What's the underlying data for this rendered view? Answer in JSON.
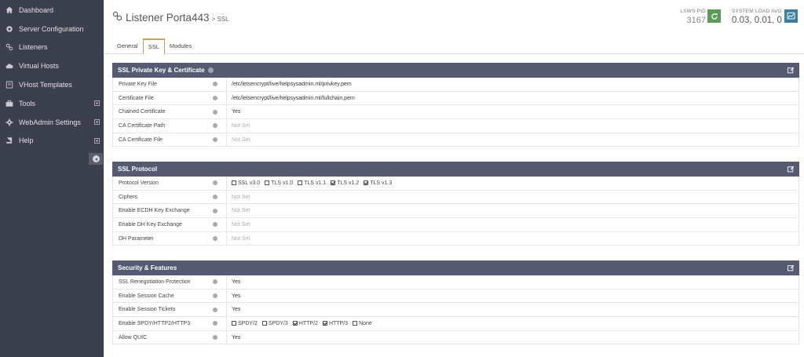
{
  "sidebar": {
    "items": [
      {
        "label": "Dashboard",
        "icon": "home-icon",
        "expandable": false
      },
      {
        "label": "Server Configuration",
        "icon": "server-icon",
        "expandable": false
      },
      {
        "label": "Listeners",
        "icon": "link-icon",
        "expandable": false
      },
      {
        "label": "Virtual Hosts",
        "icon": "cloud-icon",
        "expandable": false
      },
      {
        "label": "VHost Templates",
        "icon": "template-icon",
        "expandable": false
      },
      {
        "label": "Tools",
        "icon": "briefcase-icon",
        "expandable": true
      },
      {
        "label": "WebAdmin Settings",
        "icon": "gear-icon",
        "expandable": true
      },
      {
        "label": "Help",
        "icon": "book-icon",
        "expandable": true
      }
    ]
  },
  "header": {
    "title": "Listener Porta443",
    "subtitle": "> SSL",
    "pid_label": "LSWS PID",
    "pid_value": "3167",
    "load_label": "SYSTEM LOAD AVG",
    "load_value": "0.03, 0.01, 0"
  },
  "tabs": [
    "General",
    "SSL",
    "Modules"
  ],
  "active_tab": "SSL",
  "panels": [
    {
      "title": "SSL Private Key & Certificate",
      "rows": [
        {
          "label": "Private Key File",
          "value": "/etc/letsencrypt/live/helpsysadmin.ml/privkey.pem",
          "notset": false
        },
        {
          "label": "Certificate File",
          "value": "/etc/letsencrypt/live/helpsysadmin.ml/fullchain.pem",
          "notset": false
        },
        {
          "label": "Chained Certificate",
          "value": "Yes",
          "notset": false
        },
        {
          "label": "CA Certificate Path",
          "value": "Not Set",
          "notset": true
        },
        {
          "label": "CA Certificate File",
          "value": "Not Set",
          "notset": true
        }
      ]
    },
    {
      "title": "SSL Protocol",
      "rows": [
        {
          "label": "Protocol Version",
          "checks": [
            {
              "label": "SSL v3.0",
              "checked": false
            },
            {
              "label": "TLS v1.0",
              "checked": false
            },
            {
              "label": "TLS v1.1",
              "checked": false
            },
            {
              "label": "TLS v1.2",
              "checked": true
            },
            {
              "label": "TLS v1.3",
              "checked": true
            }
          ]
        },
        {
          "label": "Ciphers",
          "value": "Not Set",
          "notset": true
        },
        {
          "label": "Enable ECDH Key Exchange",
          "value": "Not Set",
          "notset": true
        },
        {
          "label": "Enable DH Key Exchange",
          "value": "Not Set",
          "notset": true
        },
        {
          "label": "DH Parameter",
          "value": "Not Set",
          "notset": true
        }
      ]
    },
    {
      "title": "Security & Features",
      "rows": [
        {
          "label": "SSL Renegotiation Protection",
          "value": "Yes",
          "notset": false
        },
        {
          "label": "Enable Session Cache",
          "value": "Yes",
          "notset": false
        },
        {
          "label": "Enable Session Tickets",
          "value": "Yes",
          "notset": false
        },
        {
          "label": "Enable SPDY/HTTP2/HTTP3",
          "checks": [
            {
              "label": "SPDY/2",
              "checked": false
            },
            {
              "label": "SPDY/3",
              "checked": false
            },
            {
              "label": "HTTP/2",
              "checked": true
            },
            {
              "label": "HTTP/3",
              "checked": true
            },
            {
              "label": "None",
              "checked": false
            }
          ]
        },
        {
          "label": "Allow QUIC",
          "value": "Yes",
          "notset": false
        }
      ]
    }
  ],
  "colors": {
    "sidebar_bg": "#3c3f4d",
    "panel_header_bg": "#565b73",
    "reload_button": "#5c9a5c",
    "chart_button": "#3a7fa0",
    "active_tab_accent": "#cfa25a"
  }
}
